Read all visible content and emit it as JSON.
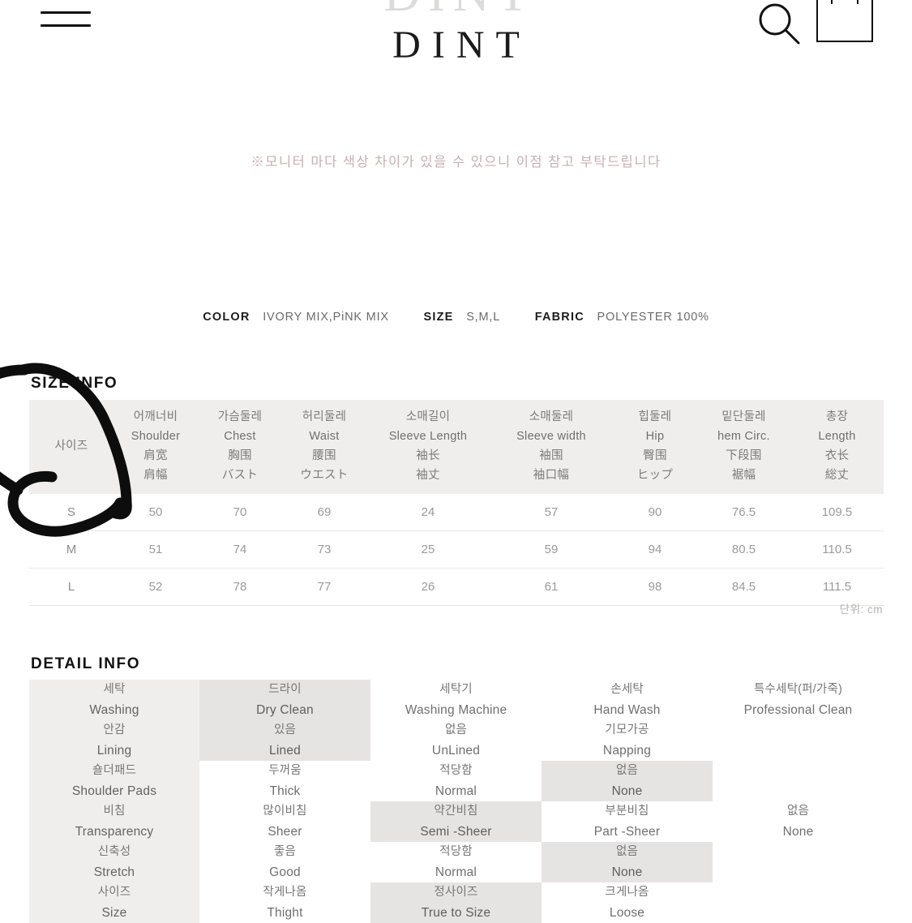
{
  "header": {
    "brand": "DINT",
    "menu_icon": "hamburger-icon",
    "search_icon": "search-icon",
    "bag_icon": "shopping-bag-icon"
  },
  "notice": "※모니터 마다 색상 차이가 있을 수 있으니 이점 참고 부탁드립니다",
  "spec": {
    "color_label": "COLOR",
    "color_value": "IVORY MIX,PiNK MIX",
    "size_label": "SIZE",
    "size_value": "S,M,L",
    "fabric_label": "FABRIC",
    "fabric_value": "POLYESTER 100%"
  },
  "size_info": {
    "title": "SIZE INFO",
    "unit": "단위: cm",
    "headers": [
      {
        "ko": "사이즈",
        "en": "",
        "cn": "",
        "jp": ""
      },
      {
        "ko": "어깨너비",
        "en": "Shoulder",
        "cn": "肩宽",
        "jp": "肩幅"
      },
      {
        "ko": "가슴둘레",
        "en": "Chest",
        "cn": "胸围",
        "jp": "バスト"
      },
      {
        "ko": "허리둘레",
        "en": "Waist",
        "cn": "腰围",
        "jp": "ウエスト"
      },
      {
        "ko": "소매길이",
        "en": "Sleeve Length",
        "cn": "袖长",
        "jp": "袖丈"
      },
      {
        "ko": "소매둘레",
        "en": "Sleeve width",
        "cn": "袖围",
        "jp": "袖口幅"
      },
      {
        "ko": "힙둘레",
        "en": "Hip",
        "cn": "臀围",
        "jp": "ヒップ"
      },
      {
        "ko": "밑단둘레",
        "en": "hem Circ.",
        "cn": "下段围",
        "jp": "裾幅"
      },
      {
        "ko": "총장",
        "en": "Length",
        "cn": "衣长",
        "jp": "総丈"
      }
    ],
    "rows": [
      [
        "S",
        "50",
        "70",
        "69",
        "24",
        "57",
        "90",
        "76.5",
        "109.5"
      ],
      [
        "M",
        "51",
        "74",
        "73",
        "25",
        "59",
        "94",
        "80.5",
        "110.5"
      ],
      [
        "L",
        "52",
        "78",
        "77",
        "26",
        "61",
        "98",
        "84.5",
        "111.5"
      ]
    ]
  },
  "detail_info": {
    "title": "DETAIL INFO",
    "rows": [
      {
        "label": {
          "ko": "세탁",
          "en": "Washing"
        },
        "cells": [
          {
            "ko": "드라이",
            "en": "Dry Clean",
            "state": "highlight"
          },
          {
            "ko": "세탁기",
            "en": "Washing Machine",
            "state": "normal"
          },
          {
            "ko": "손세탁",
            "en": "Hand Wash",
            "state": "normal"
          },
          {
            "ko": "특수세탁(퍼/가죽)",
            "en": "Professional  Clean",
            "state": "normal"
          }
        ]
      },
      {
        "label": {
          "ko": "안감",
          "en": "Lining"
        },
        "cells": [
          {
            "ko": "있음",
            "en": "Lined",
            "state": "highlight"
          },
          {
            "ko": "없음",
            "en": "UnLined",
            "state": "normal"
          },
          {
            "ko": "기모가공",
            "en": "Napping",
            "state": "normal"
          },
          {
            "ko": "",
            "en": "",
            "state": "empty"
          }
        ]
      },
      {
        "label": {
          "ko": "숄더패드",
          "en": "Shoulder  Pads"
        },
        "cells": [
          {
            "ko": "두꺼움",
            "en": "Thick",
            "state": "normal"
          },
          {
            "ko": "적당함",
            "en": "Normal",
            "state": "normal"
          },
          {
            "ko": "없음",
            "en": "None",
            "state": "highlight"
          },
          {
            "ko": "",
            "en": "",
            "state": "empty"
          }
        ]
      },
      {
        "label": {
          "ko": "비침",
          "en": "Transparency"
        },
        "cells": [
          {
            "ko": "많이비침",
            "en": "Sheer",
            "state": "normal"
          },
          {
            "ko": "약간비침",
            "en": "Semi -Sheer",
            "state": "highlight"
          },
          {
            "ko": "부분비침",
            "en": "Part -Sheer",
            "state": "normal"
          },
          {
            "ko": "없음",
            "en": "None",
            "state": "normal"
          }
        ]
      },
      {
        "label": {
          "ko": "신축성",
          "en": "Stretch"
        },
        "cells": [
          {
            "ko": "좋음",
            "en": "Good",
            "state": "normal"
          },
          {
            "ko": "적당함",
            "en": "Normal",
            "state": "normal"
          },
          {
            "ko": "없음",
            "en": "None",
            "state": "highlight"
          },
          {
            "ko": "",
            "en": "",
            "state": "empty"
          }
        ]
      },
      {
        "label": {
          "ko": "사이즈",
          "en": "Size"
        },
        "cells": [
          {
            "ko": "작게나옴",
            "en": "Thight",
            "state": "normal"
          },
          {
            "ko": "정사이즈",
            "en": "True to Size",
            "state": "highlight"
          },
          {
            "ko": "크게나옴",
            "en": "Loose",
            "state": "normal"
          },
          {
            "ko": "",
            "en": "",
            "state": "empty"
          }
        ]
      }
    ]
  }
}
